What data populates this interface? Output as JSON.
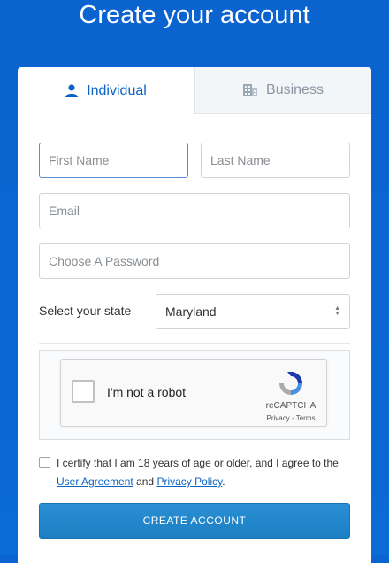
{
  "header": {
    "title": "Create your account"
  },
  "tabs": [
    {
      "label": "Individual",
      "icon": "user-icon"
    },
    {
      "label": "Business",
      "icon": "building-icon"
    }
  ],
  "form": {
    "first_name": {
      "placeholder": "First Name",
      "value": ""
    },
    "last_name": {
      "placeholder": "Last Name",
      "value": ""
    },
    "email": {
      "placeholder": "Email",
      "value": ""
    },
    "password": {
      "placeholder": "Choose A Password",
      "value": ""
    },
    "state": {
      "label": "Select your state",
      "selected": "Maryland"
    }
  },
  "captcha": {
    "label": "I'm not a robot",
    "brand": "reCAPTCHA",
    "privacy": "Privacy",
    "separator": " - ",
    "terms": "Terms"
  },
  "certify": {
    "text_before": "I certify that I am 18 years of age or older, and I agree to the",
    "user_agreement": "User Agreement",
    "and": "and",
    "privacy_policy": "Privacy Policy",
    "end": "."
  },
  "submit_label": "CREATE ACCOUNT",
  "colors": {
    "primary": "#0b63c5",
    "background": "#0a63cf",
    "button": "#1c7fc4"
  }
}
